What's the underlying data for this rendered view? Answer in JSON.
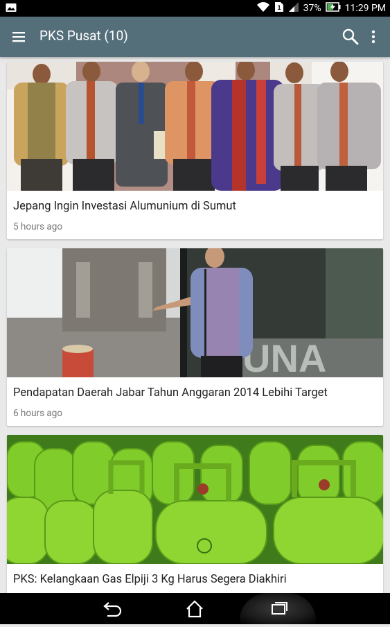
{
  "status_bar": {
    "battery_percent": "37%",
    "time": "11:29 PM"
  },
  "app_bar": {
    "title": "PKS Pusat (10)"
  },
  "articles": [
    {
      "title": "Jepang Ingin Investasi Alumunium di Sumut",
      "time": "5 hours ago"
    },
    {
      "title": "Pendapatan Daerah Jabar Tahun Anggaran 2014 Lebihi Target",
      "time": "6 hours ago"
    },
    {
      "title": "PKS: Kelangkaan Gas Elpiji 3 Kg Harus Segera Diakhiri",
      "time": ""
    }
  ],
  "colors": {
    "app_bar": "#546e7a",
    "status_bar": "#000000",
    "nav_bar": "#000000",
    "background": "#e9e9e9"
  },
  "icons": {
    "status_left": "image-notification-icon",
    "status_right": [
      "wifi-icon",
      "sim-icon",
      "signal-icon",
      "battery-charging-icon"
    ],
    "app_bar": [
      "menu-icon",
      "search-icon",
      "overflow-menu-icon"
    ],
    "nav": [
      "back-icon",
      "home-icon",
      "recent-apps-icon"
    ]
  }
}
